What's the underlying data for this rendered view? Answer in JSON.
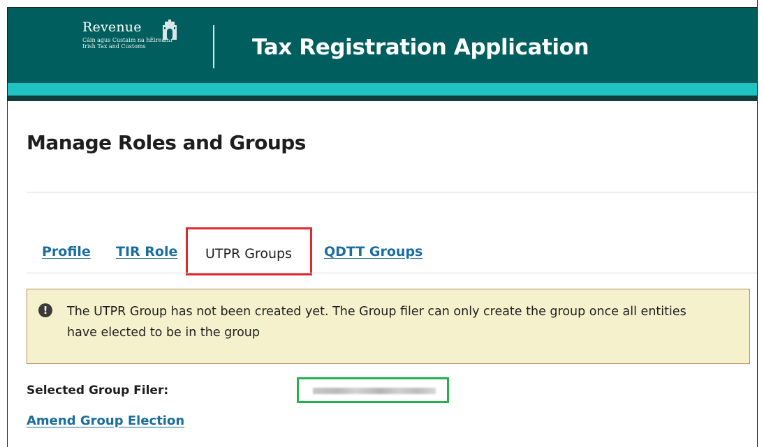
{
  "header": {
    "logo_name": "Revenue",
    "logo_sub_line1": "Cáin agus Custaim na hÉireann",
    "logo_sub_line2": "Irish Tax and Customs",
    "app_title": "Tax Registration Application",
    "logo_icon": "building-gate-icon",
    "colors": {
      "header_bg": "#005f5e",
      "accent_stripe": "#1fc3c2"
    }
  },
  "page": {
    "title": "Manage Roles and Groups"
  },
  "tabs": [
    {
      "label": "Profile",
      "active": false
    },
    {
      "label": "TIR Role",
      "active": false
    },
    {
      "label": "UTPR Groups",
      "active": true
    },
    {
      "label": "QDTT Groups",
      "active": false
    }
  ],
  "alert": {
    "icon": "exclamation-circle-icon",
    "message": "The UTPR Group has not been created yet. The Group filer can only create the group once all entities have elected to be in the group"
  },
  "group_filer": {
    "label": "Selected Group Filer:",
    "value_obscured": true
  },
  "actions": {
    "amend_label": "Amend Group Election"
  }
}
